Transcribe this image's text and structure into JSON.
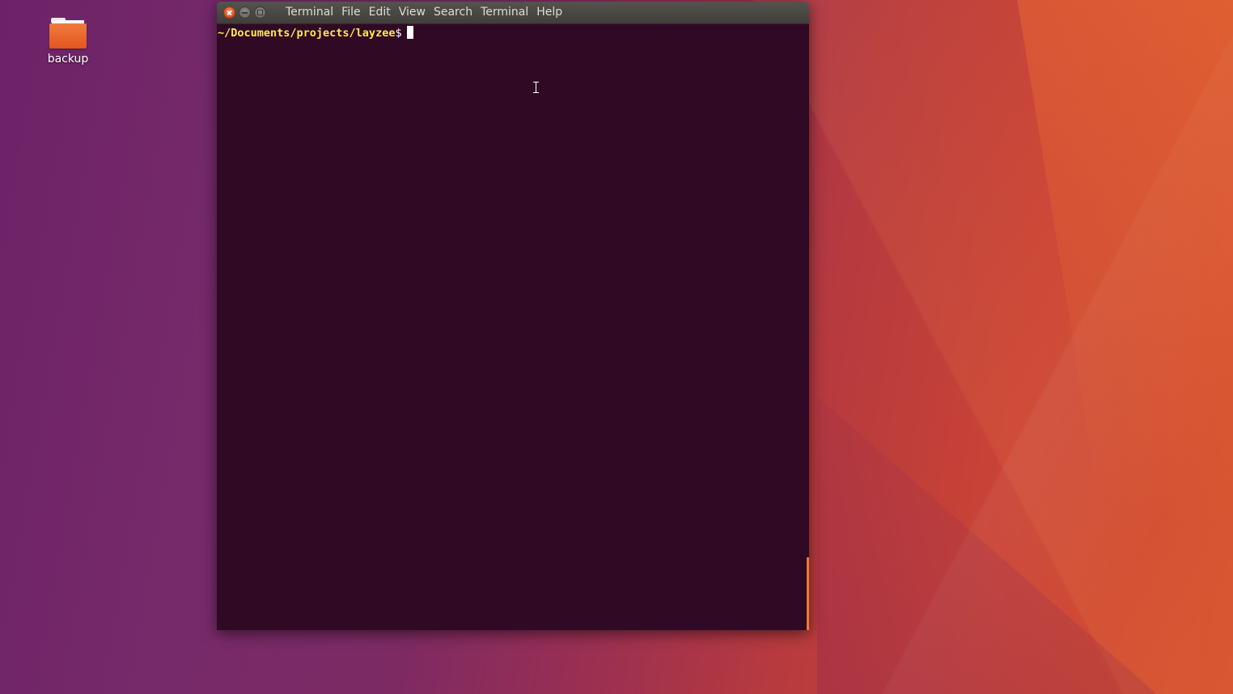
{
  "desktop": {
    "icons": [
      {
        "label": "backup",
        "icon": "folder-icon"
      }
    ]
  },
  "terminal_window": {
    "menu": [
      "Terminal",
      "File",
      "Edit",
      "View",
      "Search",
      "Terminal",
      "Help"
    ],
    "prompt": {
      "path": "~/Documents/projects/layzee",
      "symbol": "$"
    },
    "colors": {
      "background": "#300a24",
      "prompt_path": "#fce94f",
      "scroll_thumb": "#e97c32",
      "close_button": "#e2572c"
    }
  }
}
